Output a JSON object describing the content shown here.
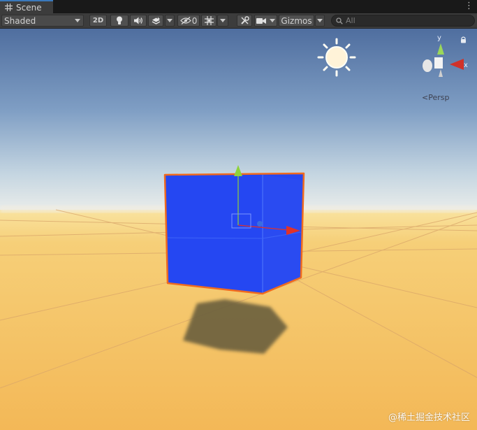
{
  "tab": {
    "label": "Scene",
    "icon": "grid-icon"
  },
  "toolbar": {
    "shading_mode": "Shaded",
    "mode_2d": "2D",
    "hidden_object_count": "0",
    "gizmos_label": "Gizmos",
    "search_placeholder": "All"
  },
  "viewport": {
    "projection_label": "<Persp",
    "axis_labels": {
      "y": "y",
      "x": "x"
    }
  },
  "watermark": "@稀土掘金技术社区",
  "colors": {
    "cube": "#2547f2",
    "selection_outline": "#f06a1e",
    "sky_top": "#4f6e9f",
    "horizon": "#e8ecec",
    "ground": "#f6c05e",
    "axis_x": "#e0322a",
    "axis_y": "#8fd23a",
    "axis_z": "#3a6de0"
  }
}
